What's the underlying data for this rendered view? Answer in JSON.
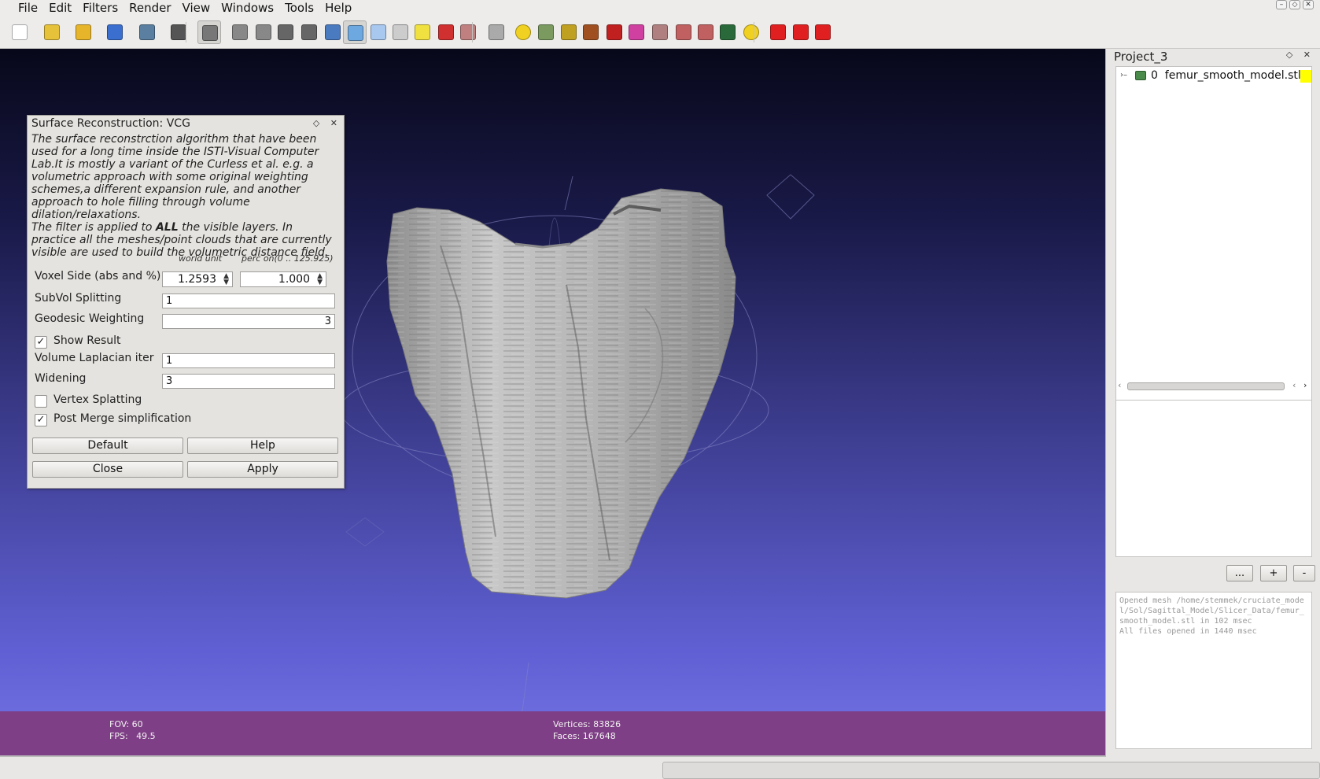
{
  "menu": [
    "File",
    "Edit",
    "Filters",
    "Render",
    "View",
    "Windows",
    "Tools",
    "Help"
  ],
  "toolbar": {
    "icons": [
      {
        "name": "new-project-icon",
        "color": "#ffffff"
      },
      {
        "name": "open-project-icon",
        "color": "#e6c23a"
      },
      {
        "name": "import-mesh-icon",
        "color": "#e6b52a"
      },
      {
        "name": "reload-icon",
        "color": "#3a6fd0"
      },
      {
        "name": "save-icon",
        "color": "#5a7fa0"
      },
      {
        "name": "snapshot-icon",
        "color": "#555555"
      },
      {
        "name": "layers-icon",
        "color": "#777777"
      },
      {
        "name": "bbox-render-icon",
        "color": "#888888"
      },
      {
        "name": "points-render-icon",
        "color": "#888888"
      },
      {
        "name": "wireframe-render-icon",
        "color": "#666666"
      },
      {
        "name": "hidden-lines-render-icon",
        "color": "#666666"
      },
      {
        "name": "flat-lines-render-icon",
        "color": "#4a7ac0"
      },
      {
        "name": "flat-render-icon",
        "color": "#6ea8e0"
      },
      {
        "name": "smooth-render-icon",
        "color": "#a8c8f0"
      },
      {
        "name": "texture-render-icon",
        "color": "#cccccc"
      },
      {
        "name": "light-icon",
        "color": "#f0e040"
      },
      {
        "name": "backface-icon",
        "color": "#d03030"
      },
      {
        "name": "selection-render-icon",
        "color": "#c08080"
      },
      {
        "name": "manipulator-icon",
        "color": "#aaaaaa"
      },
      {
        "name": "annotation-icon",
        "color": "#f0d020"
      },
      {
        "name": "ao-icon",
        "color": "#7a9a60"
      },
      {
        "name": "paint-icon",
        "color": "#c0a020"
      },
      {
        "name": "brush-icon",
        "color": "#a05020"
      },
      {
        "name": "pickpoints-icon",
        "color": "#c02020"
      },
      {
        "name": "color-icon",
        "color": "#d040a0"
      },
      {
        "name": "select-faces-icon",
        "color": "#b08080"
      },
      {
        "name": "select-vertices-icon",
        "color": "#c06060"
      },
      {
        "name": "select-connected-icon",
        "color": "#c06060"
      },
      {
        "name": "raster-icon",
        "color": "#2a6a3a"
      },
      {
        "name": "info-icon",
        "color": "#f0d020"
      },
      {
        "name": "delete-faces-icon",
        "color": "#e02020"
      },
      {
        "name": "delete-vertices-icon",
        "color": "#e02020"
      },
      {
        "name": "delete-selection-icon",
        "color": "#e02020"
      }
    ]
  },
  "viewport": {
    "fov_label": "FOV: 60",
    "fps_label": "FPS:   49.5",
    "vertices_label": "Vertices: 83826",
    "faces_label": "Faces: 167648"
  },
  "dialog": {
    "title": "Surface Reconstruction: VCG",
    "desc_1": "The surface reconstrction algorithm that have been used for a long time inside the ISTI-Visual Computer Lab.It is mostly a variant of the Curless et al. e.g. a volumetric approach with some original weighting schemes,a different expansion rule, and another approach to hole filling through volume dilation/relaxations.",
    "desc_2a": "The filter is applied to ",
    "desc_2b": "ALL",
    "desc_2c": " the visible layers. In practice all the meshes/point clouds that are currently visible are used to build the volumetric distance field.",
    "col_world": "world unit",
    "col_perc": "perc on(0 .. 125.925)",
    "voxel_label": "Voxel Side (abs and %)",
    "voxel_abs": "1.2593",
    "voxel_perc": "1.000",
    "subvol_label": "SubVol Splitting",
    "subvol_value": "1",
    "geodesic_label": "Geodesic Weighting",
    "geodesic_value": "3",
    "show_result_label": "Show Result",
    "show_result_checked": true,
    "laplacian_label": "Volume Laplacian iter",
    "laplacian_value": "1",
    "widening_label": "Widening",
    "widening_value": "3",
    "vertex_splatting_label": "Vertex Splatting",
    "vertex_splatting_checked": false,
    "post_merge_label": "Post Merge simplification",
    "post_merge_checked": true,
    "btn_default": "Default",
    "btn_help": "Help",
    "btn_close": "Close",
    "btn_apply": "Apply"
  },
  "panel": {
    "project_title": "Project_3",
    "layer_label": "0  femur_smooth_model.stl",
    "layer_color": "#ffff00",
    "btn_more": "...",
    "btn_add": "+",
    "btn_remove": "-",
    "log_text": "Opened mesh /home/stemmek/cruciate_model/Sol/Sagittal_Model/Slicer_Data/femur_smooth_model.stl in 102 msec\nAll files opened in 1440 msec"
  }
}
